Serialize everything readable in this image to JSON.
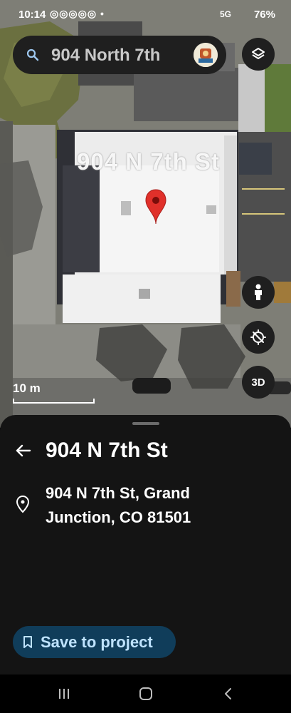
{
  "status_bar": {
    "time": "10:14",
    "notifications": "◎◎◎◎◎ •",
    "network": "5G",
    "battery": "76%"
  },
  "search": {
    "query": "904 North 7th",
    "icon": "search-icon"
  },
  "map": {
    "place_label": "904 N 7th St",
    "scale_label": "10 m",
    "pin_color": "#e0302a",
    "buttons": {
      "layers": "layers-icon",
      "street_view": "pegman-icon",
      "compass": "compass-icon",
      "view_3d": "3D"
    }
  },
  "sheet": {
    "title": "904 N 7th St",
    "address_line1": "904 N 7th St, Grand",
    "address_line2": "Junction, CO 81501",
    "save_label": "Save to project",
    "accent": "#103d5a"
  },
  "nav": {
    "recent": "recent-apps-icon",
    "home": "home-icon",
    "back": "back-icon"
  }
}
